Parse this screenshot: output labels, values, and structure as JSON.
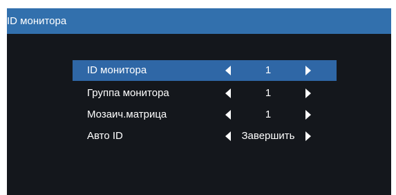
{
  "window": {
    "title": "ID монитора"
  },
  "menu": {
    "items": [
      {
        "label": "ID монитора",
        "value": "1",
        "selected": true
      },
      {
        "label": "Группа монитора",
        "value": "1",
        "selected": false
      },
      {
        "label": "Мозаич.матрица",
        "value": "1",
        "selected": false
      },
      {
        "label": "Авто ID",
        "value": "Завершить",
        "selected": false
      }
    ]
  },
  "colors": {
    "header": "#3270ad",
    "selection": "#2f67a6",
    "background": "#14171c",
    "text": "#ffffff"
  }
}
